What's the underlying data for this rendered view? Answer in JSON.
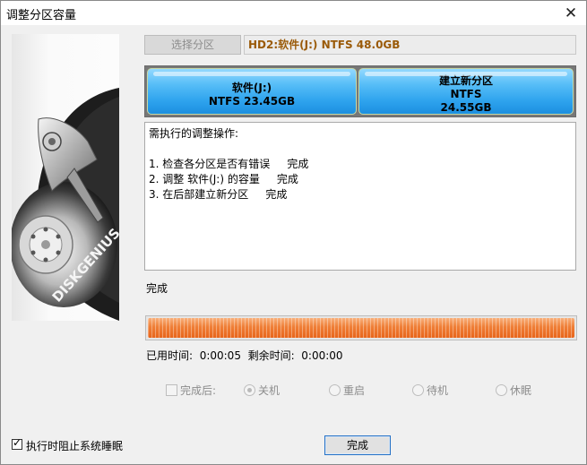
{
  "window": {
    "title": "调整分区容量",
    "close_symbol": "✕"
  },
  "side_image": {
    "brand_text": "DISKGENIUS"
  },
  "toolbar": {
    "select_partition_label": "选择分区",
    "disk_info": "HD2:软件(J:) NTFS 48.0GB"
  },
  "partitions": [
    {
      "lines": [
        "软件(J:)",
        "NTFS 23.45GB"
      ]
    },
    {
      "lines": [
        "建立新分区",
        "NTFS",
        "24.55GB"
      ]
    }
  ],
  "operations": {
    "header": "需执行的调整操作:",
    "items": [
      "1. 检查各分区是否有错误     完成",
      "2. 调整 软件(J:) 的容量     完成",
      "3. 在后部建立新分区     完成"
    ]
  },
  "status": "完成",
  "progress": {
    "percent": 100
  },
  "time": {
    "elapsed_label": "已用时间:",
    "elapsed_value": "0:00:05",
    "remaining_label": "剩余时间:",
    "remaining_value": "0:00:00"
  },
  "after_finish": {
    "label": "完成后:",
    "checked": false,
    "options": [
      "关机",
      "重启",
      "待机",
      "休眠"
    ],
    "selected": "关机"
  },
  "bottom": {
    "prevent_sleep_label": "执行时阻止系统睡眠",
    "prevent_sleep_checked": true,
    "check_mark": "✓",
    "finish_button_label": "完成"
  },
  "colors": {
    "disk_info_text": "#9a5a08",
    "partition_fill": "#2fa4ee",
    "progress_fill": "#ef7e36",
    "button_border": "#2672c6"
  }
}
